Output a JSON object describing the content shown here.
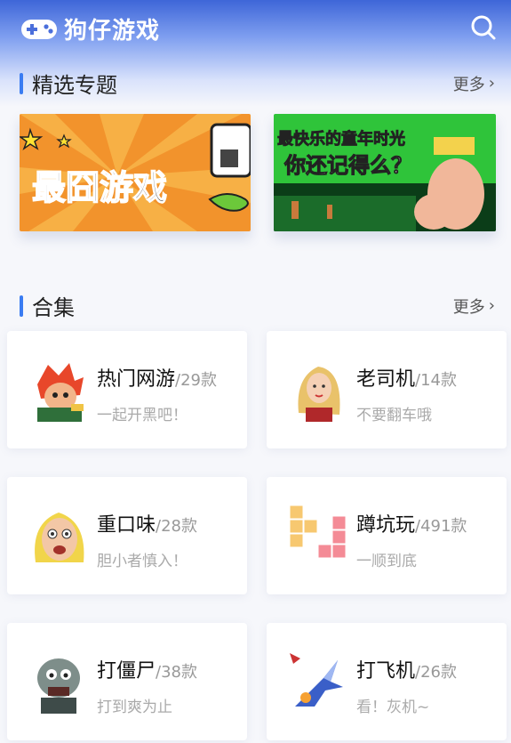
{
  "app": {
    "title": "狗仔游戏"
  },
  "featured": {
    "title": "精选专题",
    "more_label": "更多"
  },
  "banners": [
    {
      "text": "最囧游戏"
    },
    {
      "line1": "最快乐的童年时光",
      "line2": "你还记得么？"
    }
  ],
  "collections": {
    "title": "合集",
    "more_label": "更多",
    "items": [
      {
        "name": "热门网游",
        "count": "/29款",
        "desc": "一起开黑吧！",
        "icon": "hero-icon"
      },
      {
        "name": "老司机",
        "count": "/14款",
        "desc": "不要翻车哦",
        "icon": "girl-icon"
      },
      {
        "name": "重口味",
        "count": "/28款",
        "desc": "胆小者慎入！",
        "icon": "funny-face-icon"
      },
      {
        "name": "蹲坑玩",
        "count": "/491款",
        "desc": "一顺到底",
        "icon": "blocks-icon"
      },
      {
        "name": "打僵尸",
        "count": "/38款",
        "desc": "打到爽为止",
        "icon": "zombie-icon"
      },
      {
        "name": "打飞机",
        "count": "/26款",
        "desc": "看！灰机~",
        "icon": "jet-icon"
      }
    ]
  },
  "colors": {
    "accent": "#3a7cf2",
    "header": "#3e66d8"
  }
}
